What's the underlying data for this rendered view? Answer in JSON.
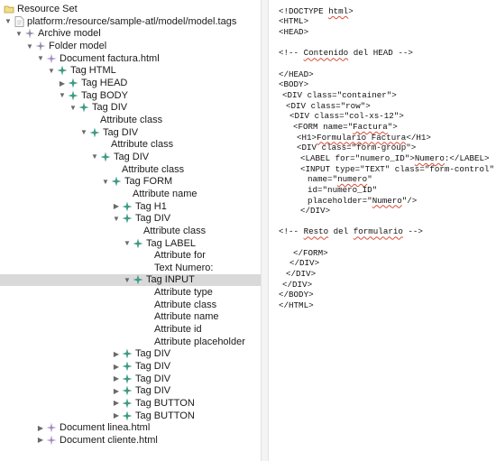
{
  "tree": {
    "items": [
      {
        "label": "Resource Set",
        "icon": "resource-set-icon",
        "depth": 0,
        "twisty": "none"
      },
      {
        "label": "platform:/resource/sample-atl/model/model.tags",
        "icon": "model-file-icon",
        "depth": 1,
        "twisty": "expanded"
      },
      {
        "label": "Archive model",
        "icon": "archive-model-icon",
        "depth": 2,
        "twisty": "expanded"
      },
      {
        "label": "Folder model",
        "icon": "folder-model-icon",
        "depth": 3,
        "twisty": "expanded"
      },
      {
        "label": "Document factura.html",
        "icon": "document-icon",
        "depth": 4,
        "twisty": "expanded"
      },
      {
        "label": "Tag HTML",
        "icon": "tag-icon",
        "depth": 5,
        "twisty": "expanded"
      },
      {
        "label": "Tag HEAD",
        "icon": "tag-icon",
        "depth": 6,
        "twisty": "collapsed"
      },
      {
        "label": "Tag BODY",
        "icon": "tag-icon",
        "depth": 6,
        "twisty": "expanded"
      },
      {
        "label": "Tag DIV",
        "icon": "tag-icon",
        "depth": 7,
        "twisty": "expanded"
      },
      {
        "label": "Attribute class",
        "icon": "none",
        "depth": 9,
        "twisty": "none"
      },
      {
        "label": "Tag DIV",
        "icon": "tag-icon",
        "depth": 8,
        "twisty": "expanded"
      },
      {
        "label": "Attribute class",
        "icon": "none",
        "depth": 10,
        "twisty": "none"
      },
      {
        "label": "Tag DIV",
        "icon": "tag-icon",
        "depth": 9,
        "twisty": "expanded"
      },
      {
        "label": "Attribute class",
        "icon": "none",
        "depth": 11,
        "twisty": "none"
      },
      {
        "label": "Tag FORM",
        "icon": "tag-icon",
        "depth": 10,
        "twisty": "expanded"
      },
      {
        "label": "Attribute name",
        "icon": "none",
        "depth": 12,
        "twisty": "none"
      },
      {
        "label": "Tag H1",
        "icon": "tag-icon",
        "depth": 11,
        "twisty": "collapsed"
      },
      {
        "label": "Tag DIV",
        "icon": "tag-icon",
        "depth": 11,
        "twisty": "expanded"
      },
      {
        "label": "Attribute class",
        "icon": "none",
        "depth": 13,
        "twisty": "none"
      },
      {
        "label": "Tag LABEL",
        "icon": "tag-icon",
        "depth": 12,
        "twisty": "expanded"
      },
      {
        "label": "Attribute for",
        "icon": "none",
        "depth": 14,
        "twisty": "none"
      },
      {
        "label": "Text Numero:",
        "icon": "none",
        "depth": 14,
        "twisty": "none"
      },
      {
        "label": "Tag INPUT",
        "icon": "tag-icon",
        "depth": 12,
        "twisty": "expanded",
        "selected": true
      },
      {
        "label": "Attribute type",
        "icon": "none",
        "depth": 14,
        "twisty": "none"
      },
      {
        "label": "Attribute class",
        "icon": "none",
        "depth": 14,
        "twisty": "none"
      },
      {
        "label": "Attribute name",
        "icon": "none",
        "depth": 14,
        "twisty": "none"
      },
      {
        "label": "Attribute id",
        "icon": "none",
        "depth": 14,
        "twisty": "none"
      },
      {
        "label": "Attribute placeholder",
        "icon": "none",
        "depth": 14,
        "twisty": "none"
      },
      {
        "label": "Tag DIV",
        "icon": "tag-icon",
        "depth": 11,
        "twisty": "collapsed"
      },
      {
        "label": "Tag DIV",
        "icon": "tag-icon",
        "depth": 11,
        "twisty": "collapsed"
      },
      {
        "label": "Tag DIV",
        "icon": "tag-icon",
        "depth": 11,
        "twisty": "collapsed"
      },
      {
        "label": "Tag DIV",
        "icon": "tag-icon",
        "depth": 11,
        "twisty": "collapsed"
      },
      {
        "label": "Tag BUTTON",
        "icon": "tag-icon",
        "depth": 11,
        "twisty": "collapsed"
      },
      {
        "label": "Tag BUTTON",
        "icon": "tag-icon",
        "depth": 11,
        "twisty": "collapsed"
      },
      {
        "label": "Document linea.html",
        "icon": "document-icon",
        "depth": 4,
        "twisty": "collapsed"
      },
      {
        "label": "Document cliente.html",
        "icon": "document-icon",
        "depth": 4,
        "twisty": "collapsed"
      }
    ]
  },
  "code": {
    "lines": [
      {
        "indent": 0,
        "segments": [
          {
            "text": "<!DOCTYPE "
          },
          {
            "text": "html",
            "sq": true
          },
          {
            "text": ">"
          }
        ]
      },
      {
        "indent": 0,
        "segments": [
          {
            "text": "<HTML>"
          }
        ]
      },
      {
        "indent": 0,
        "segments": [
          {
            "text": "<HEAD>"
          }
        ]
      },
      {
        "indent": 0,
        "segments": [
          {
            "text": ""
          }
        ]
      },
      {
        "indent": 0,
        "segments": [
          {
            "text": "<!-- "
          },
          {
            "text": "Contenido",
            "sq": true
          },
          {
            "text": " del HEAD -->"
          }
        ]
      },
      {
        "indent": 0,
        "segments": [
          {
            "text": ""
          }
        ]
      },
      {
        "indent": 0,
        "segments": [
          {
            "text": "</HEAD>"
          }
        ]
      },
      {
        "indent": 0,
        "segments": [
          {
            "text": "<BODY>"
          }
        ]
      },
      {
        "indent": 1,
        "segments": [
          {
            "text": "<DIV class=\"container\">"
          }
        ]
      },
      {
        "indent": 2,
        "segments": [
          {
            "text": "<DIV class=\"row\">"
          }
        ]
      },
      {
        "indent": 3,
        "segments": [
          {
            "text": "<DIV class=\"col-xs-12\">"
          }
        ]
      },
      {
        "indent": 4,
        "segments": [
          {
            "text": "<FORM name=\""
          },
          {
            "text": "Factura",
            "sq": true
          },
          {
            "text": "\">"
          }
        ]
      },
      {
        "indent": 5,
        "segments": [
          {
            "text": "<H1>"
          },
          {
            "text": "Formulario Factura",
            "sq": true
          },
          {
            "text": "</H1>"
          }
        ]
      },
      {
        "indent": 5,
        "segments": [
          {
            "text": "<DIV class=\"form-group\">"
          }
        ]
      },
      {
        "indent": 6,
        "segments": [
          {
            "text": "<LABEL for=\"numero_ID\">"
          },
          {
            "text": "Numero",
            "sq": true
          },
          {
            "text": ":</LABEL>"
          }
        ]
      },
      {
        "indent": 6,
        "segments": [
          {
            "text": "<INPUT type=\"TEXT\" class=\"form-control\""
          }
        ]
      },
      {
        "indent": 8,
        "segments": [
          {
            "text": "name=\""
          },
          {
            "text": "numero",
            "sq": true
          },
          {
            "text": "\""
          }
        ]
      },
      {
        "indent": 8,
        "segments": [
          {
            "text": "id=\"numero_ID\""
          }
        ]
      },
      {
        "indent": 8,
        "segments": [
          {
            "text": "placeholder=\""
          },
          {
            "text": "Numero",
            "sq": true
          },
          {
            "text": "\"/>"
          }
        ]
      },
      {
        "indent": 6,
        "segments": [
          {
            "text": "</DIV>"
          }
        ]
      },
      {
        "indent": 0,
        "segments": [
          {
            "text": ""
          }
        ]
      },
      {
        "indent": 0,
        "segments": [
          {
            "text": "<!-- "
          },
          {
            "text": "Resto",
            "sq": true
          },
          {
            "text": " del "
          },
          {
            "text": "formulario",
            "sq": true
          },
          {
            "text": " -->"
          }
        ]
      },
      {
        "indent": 0,
        "segments": [
          {
            "text": ""
          }
        ]
      },
      {
        "indent": 4,
        "segments": [
          {
            "text": "</FORM>"
          }
        ]
      },
      {
        "indent": 3,
        "segments": [
          {
            "text": "</DIV>"
          }
        ]
      },
      {
        "indent": 2,
        "segments": [
          {
            "text": "</DIV>"
          }
        ]
      },
      {
        "indent": 1,
        "segments": [
          {
            "text": "</DIV>"
          }
        ]
      },
      {
        "indent": 0,
        "segments": [
          {
            "text": "</BODY>"
          }
        ]
      },
      {
        "indent": 0,
        "segments": [
          {
            "text": "</HTML>"
          }
        ]
      }
    ]
  },
  "colors": {
    "selection": "#d9d9d9",
    "tag_icon": "#3f9b86",
    "model_icon": "#8b8fa8",
    "document_icon": "#a48cc2",
    "squiggle": "#d94a38"
  }
}
